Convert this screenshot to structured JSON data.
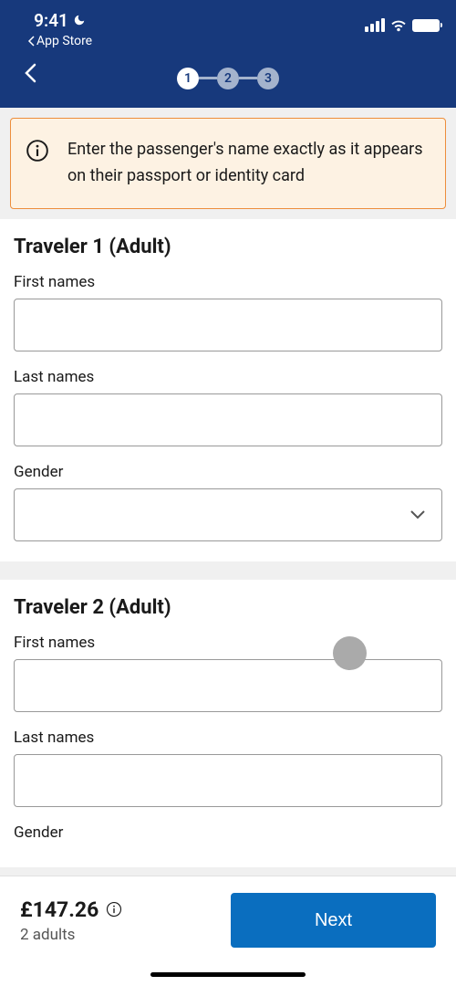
{
  "status_bar": {
    "time": "9:41",
    "app_store_back": "App Store"
  },
  "stepper": {
    "steps": [
      "1",
      "2",
      "3"
    ],
    "active_index": 0
  },
  "info_banner": {
    "text": "Enter the passenger's name exactly as it appears on their passport or identity card"
  },
  "travelers": [
    {
      "heading": "Traveler 1 (Adult)",
      "first_names_label": "First names",
      "first_names_value": "",
      "last_names_label": "Last names",
      "last_names_value": "",
      "gender_label": "Gender",
      "gender_value": ""
    },
    {
      "heading": "Traveler 2 (Adult)",
      "first_names_label": "First names",
      "first_names_value": "",
      "last_names_label": "Last names",
      "last_names_value": "",
      "gender_label": "Gender",
      "gender_value": ""
    }
  ],
  "footer": {
    "price": "£147.26",
    "passenger_count": "2 adults",
    "next_label": "Next"
  }
}
